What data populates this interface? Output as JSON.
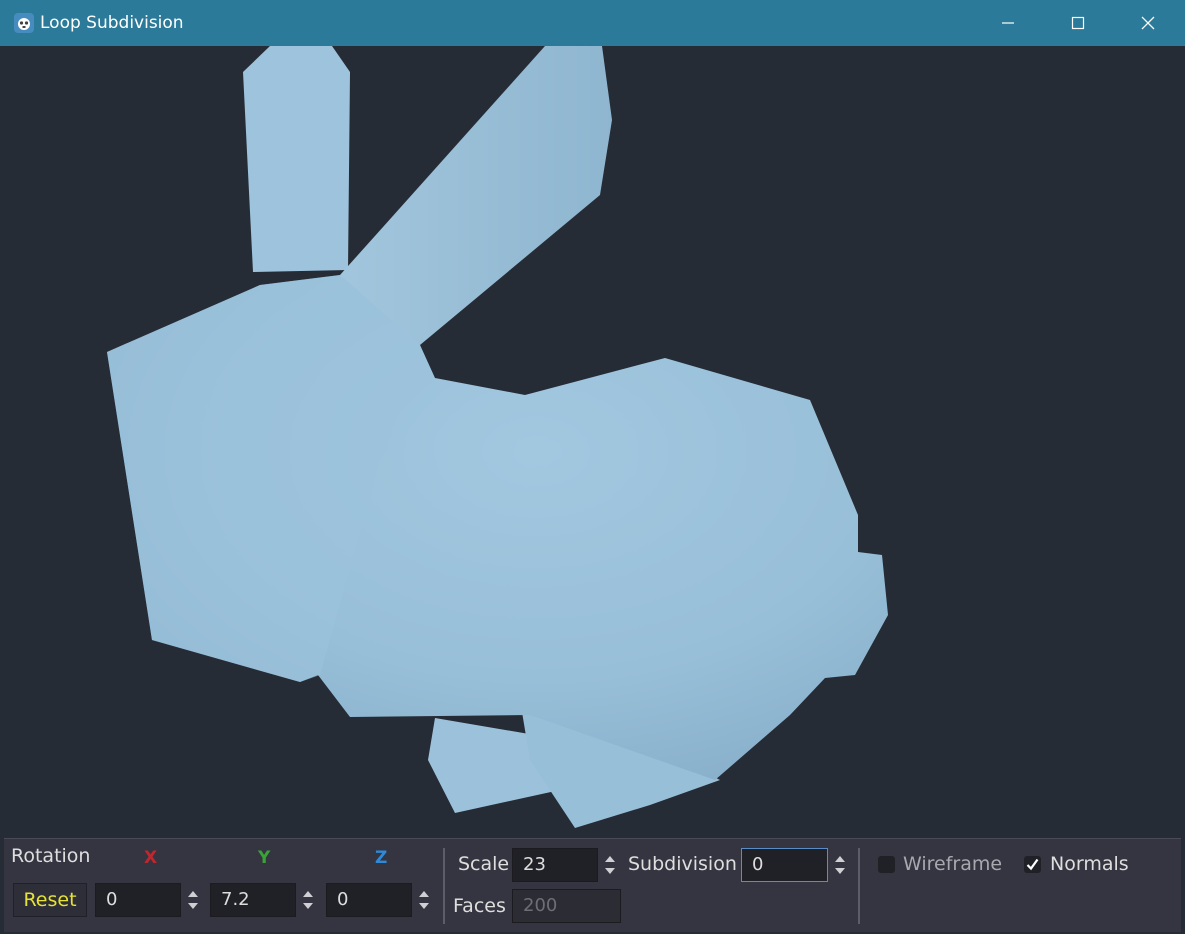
{
  "window": {
    "title": "Loop Subdivision",
    "app_icon": "godot-icon",
    "controls": [
      "minimize-icon",
      "maximize-icon",
      "close-icon"
    ],
    "titlebar_color": "#2b7a99"
  },
  "viewport": {
    "background_color": "#262c36",
    "model_color": "#9cc3dc",
    "model_icon": "bunny-mesh"
  },
  "rotation": {
    "label": "Rotation",
    "reset_label": "Reset",
    "x": {
      "label": "X",
      "value": "0",
      "color": "#c0262e"
    },
    "y": {
      "label": "Y",
      "value": "7.2",
      "color": "#3aa338"
    },
    "z": {
      "label": "Z",
      "value": "0",
      "color": "#2e8ad8"
    }
  },
  "scale": {
    "label": "Scale",
    "value": "23"
  },
  "subdivision": {
    "label": "Subdivision",
    "value": "0"
  },
  "faces": {
    "label": "Faces",
    "value": "200"
  },
  "wireframe": {
    "label": "Wireframe",
    "checked": false
  },
  "normals": {
    "label": "Normals",
    "checked": true
  }
}
